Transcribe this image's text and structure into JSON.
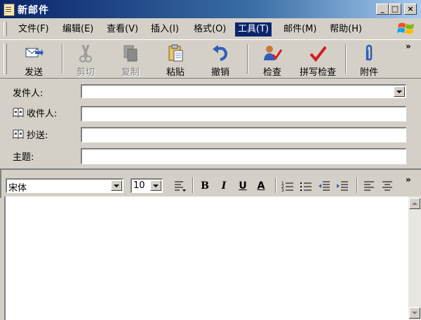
{
  "window": {
    "title": "新邮件",
    "controls": {
      "minimize": "_",
      "maximize": "□",
      "close": "×"
    }
  },
  "menu": {
    "items": [
      {
        "label": "文件(F)"
      },
      {
        "label": "编辑(E)"
      },
      {
        "label": "查看(V)"
      },
      {
        "label": "插入(I)"
      },
      {
        "label": "格式(O)"
      },
      {
        "label": "工具(T)"
      },
      {
        "label": "邮件(M)"
      },
      {
        "label": "帮助(H)"
      }
    ],
    "active_index": 5
  },
  "toolbar": {
    "send": "发送",
    "cut": "剪切",
    "copy": "复制",
    "paste": "粘贴",
    "undo": "撤销",
    "check": "检查",
    "spellcheck": "拼写检查",
    "attach": "附件",
    "overflow": "»"
  },
  "fields": {
    "from_label": "发件人:",
    "to_label": "收件人:",
    "cc_label": "抄送:",
    "subject_label": "主题:",
    "from_value": "",
    "to_value": "",
    "cc_value": "",
    "subject_value": ""
  },
  "format": {
    "font_name": "宋体",
    "font_size": "10",
    "bold": "B",
    "italic": "I",
    "underline": "U",
    "font_color": "A",
    "overflow": "»"
  },
  "colors": {
    "titlebar_start": "#0a246a",
    "titlebar_end": "#a6caf0",
    "menu_highlight": "#0a246a",
    "face": "#d4d0c8"
  }
}
